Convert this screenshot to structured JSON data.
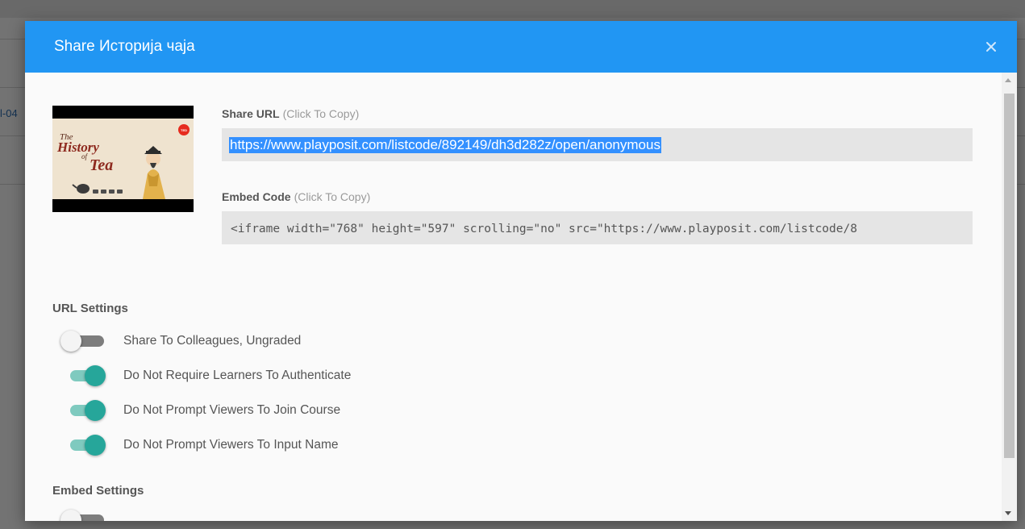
{
  "background": {
    "partial_text": "l-04"
  },
  "modal": {
    "title": "Share Историја чаја",
    "close_icon": "close-icon",
    "thumbnail": {
      "title_line1": "The",
      "title_line2": "History",
      "title_line3": "of",
      "title_line4": "Tea",
      "badge": "TED"
    },
    "share_url": {
      "label": "Share URL",
      "hint": "(Click To Copy)",
      "value": "https://www.playposit.com/listcode/892149/dh3d282z/open/anonymous"
    },
    "embed_code": {
      "label": "Embed Code",
      "hint": "(Click To Copy)",
      "value": "<iframe width=\"768\" height=\"597\" scrolling=\"no\" src=\"https://www.playposit.com/listcode/8"
    },
    "url_settings": {
      "title": "URL Settings",
      "toggles": [
        {
          "label": "Share To Colleagues, Ungraded",
          "on": false
        },
        {
          "label": "Do Not Require Learners To Authenticate",
          "on": true
        },
        {
          "label": "Do Not Prompt Viewers To Join Course",
          "on": true
        },
        {
          "label": "Do Not Prompt Viewers To Input Name",
          "on": true
        }
      ]
    },
    "embed_settings": {
      "title": "Embed Settings"
    }
  },
  "colors": {
    "header": "#2196f3",
    "toggle_on": "#26a69a",
    "selection": "#3390ff"
  }
}
